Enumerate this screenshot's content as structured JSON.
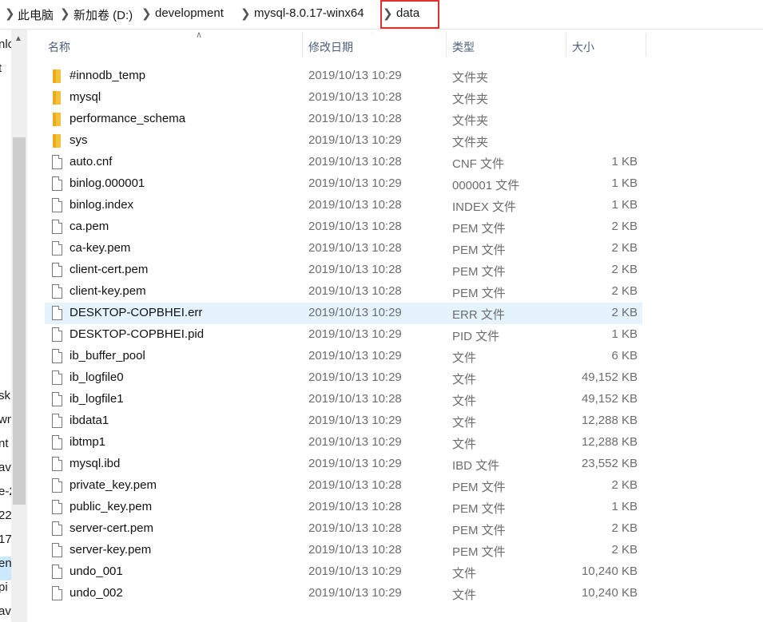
{
  "breadcrumb": [
    "此电脑",
    "新加卷 (D:)",
    "development",
    "mysql-8.0.17-winx64",
    "data"
  ],
  "nav": {
    "fragments": [
      "nlo",
      "t",
      "sk",
      "wn",
      "nt",
      "av",
      "e-2",
      "22",
      "17",
      "en",
      "pi",
      "av"
    ]
  },
  "columns": {
    "name": "名称",
    "date": "修改日期",
    "type": "类型",
    "size": "大小"
  },
  "files": [
    {
      "name": "#innodb_temp",
      "date": "2019/10/13 10:29",
      "type": "文件夹",
      "size": "",
      "kind": "folder"
    },
    {
      "name": "mysql",
      "date": "2019/10/13 10:28",
      "type": "文件夹",
      "size": "",
      "kind": "folder"
    },
    {
      "name": "performance_schema",
      "date": "2019/10/13 10:28",
      "type": "文件夹",
      "size": "",
      "kind": "folder"
    },
    {
      "name": "sys",
      "date": "2019/10/13 10:29",
      "type": "文件夹",
      "size": "",
      "kind": "folder"
    },
    {
      "name": "auto.cnf",
      "date": "2019/10/13 10:28",
      "type": "CNF 文件",
      "size": "1 KB",
      "kind": "file"
    },
    {
      "name": "binlog.000001",
      "date": "2019/10/13 10:29",
      "type": "000001 文件",
      "size": "1 KB",
      "kind": "file"
    },
    {
      "name": "binlog.index",
      "date": "2019/10/13 10:28",
      "type": "INDEX 文件",
      "size": "1 KB",
      "kind": "file"
    },
    {
      "name": "ca.pem",
      "date": "2019/10/13 10:28",
      "type": "PEM 文件",
      "size": "2 KB",
      "kind": "file"
    },
    {
      "name": "ca-key.pem",
      "date": "2019/10/13 10:28",
      "type": "PEM 文件",
      "size": "2 KB",
      "kind": "file"
    },
    {
      "name": "client-cert.pem",
      "date": "2019/10/13 10:28",
      "type": "PEM 文件",
      "size": "2 KB",
      "kind": "file"
    },
    {
      "name": "client-key.pem",
      "date": "2019/10/13 10:28",
      "type": "PEM 文件",
      "size": "2 KB",
      "kind": "file"
    },
    {
      "name": "DESKTOP-COPBHEI.err",
      "date": "2019/10/13 10:29",
      "type": "ERR 文件",
      "size": "2 KB",
      "kind": "file",
      "selected": true
    },
    {
      "name": "DESKTOP-COPBHEI.pid",
      "date": "2019/10/13 10:29",
      "type": "PID 文件",
      "size": "1 KB",
      "kind": "file"
    },
    {
      "name": "ib_buffer_pool",
      "date": "2019/10/13 10:29",
      "type": "文件",
      "size": "6 KB",
      "kind": "file"
    },
    {
      "name": "ib_logfile0",
      "date": "2019/10/13 10:29",
      "type": "文件",
      "size": "49,152 KB",
      "kind": "file"
    },
    {
      "name": "ib_logfile1",
      "date": "2019/10/13 10:28",
      "type": "文件",
      "size": "49,152 KB",
      "kind": "file"
    },
    {
      "name": "ibdata1",
      "date": "2019/10/13 10:29",
      "type": "文件",
      "size": "12,288 KB",
      "kind": "file"
    },
    {
      "name": "ibtmp1",
      "date": "2019/10/13 10:29",
      "type": "文件",
      "size": "12,288 KB",
      "kind": "file"
    },
    {
      "name": "mysql.ibd",
      "date": "2019/10/13 10:29",
      "type": "IBD 文件",
      "size": "23,552 KB",
      "kind": "file"
    },
    {
      "name": "private_key.pem",
      "date": "2019/10/13 10:28",
      "type": "PEM 文件",
      "size": "2 KB",
      "kind": "file"
    },
    {
      "name": "public_key.pem",
      "date": "2019/10/13 10:28",
      "type": "PEM 文件",
      "size": "1 KB",
      "kind": "file"
    },
    {
      "name": "server-cert.pem",
      "date": "2019/10/13 10:28",
      "type": "PEM 文件",
      "size": "2 KB",
      "kind": "file"
    },
    {
      "name": "server-key.pem",
      "date": "2019/10/13 10:28",
      "type": "PEM 文件",
      "size": "2 KB",
      "kind": "file"
    },
    {
      "name": "undo_001",
      "date": "2019/10/13 10:29",
      "type": "文件",
      "size": "10,240 KB",
      "kind": "file"
    },
    {
      "name": "undo_002",
      "date": "2019/10/13 10:29",
      "type": "文件",
      "size": "10,240 KB",
      "kind": "file"
    }
  ],
  "colors": {
    "selected_row": "#e5f3ff",
    "highlight_box": "#e03030",
    "folder": "#f4c23a",
    "header_text": "#4c607a"
  }
}
